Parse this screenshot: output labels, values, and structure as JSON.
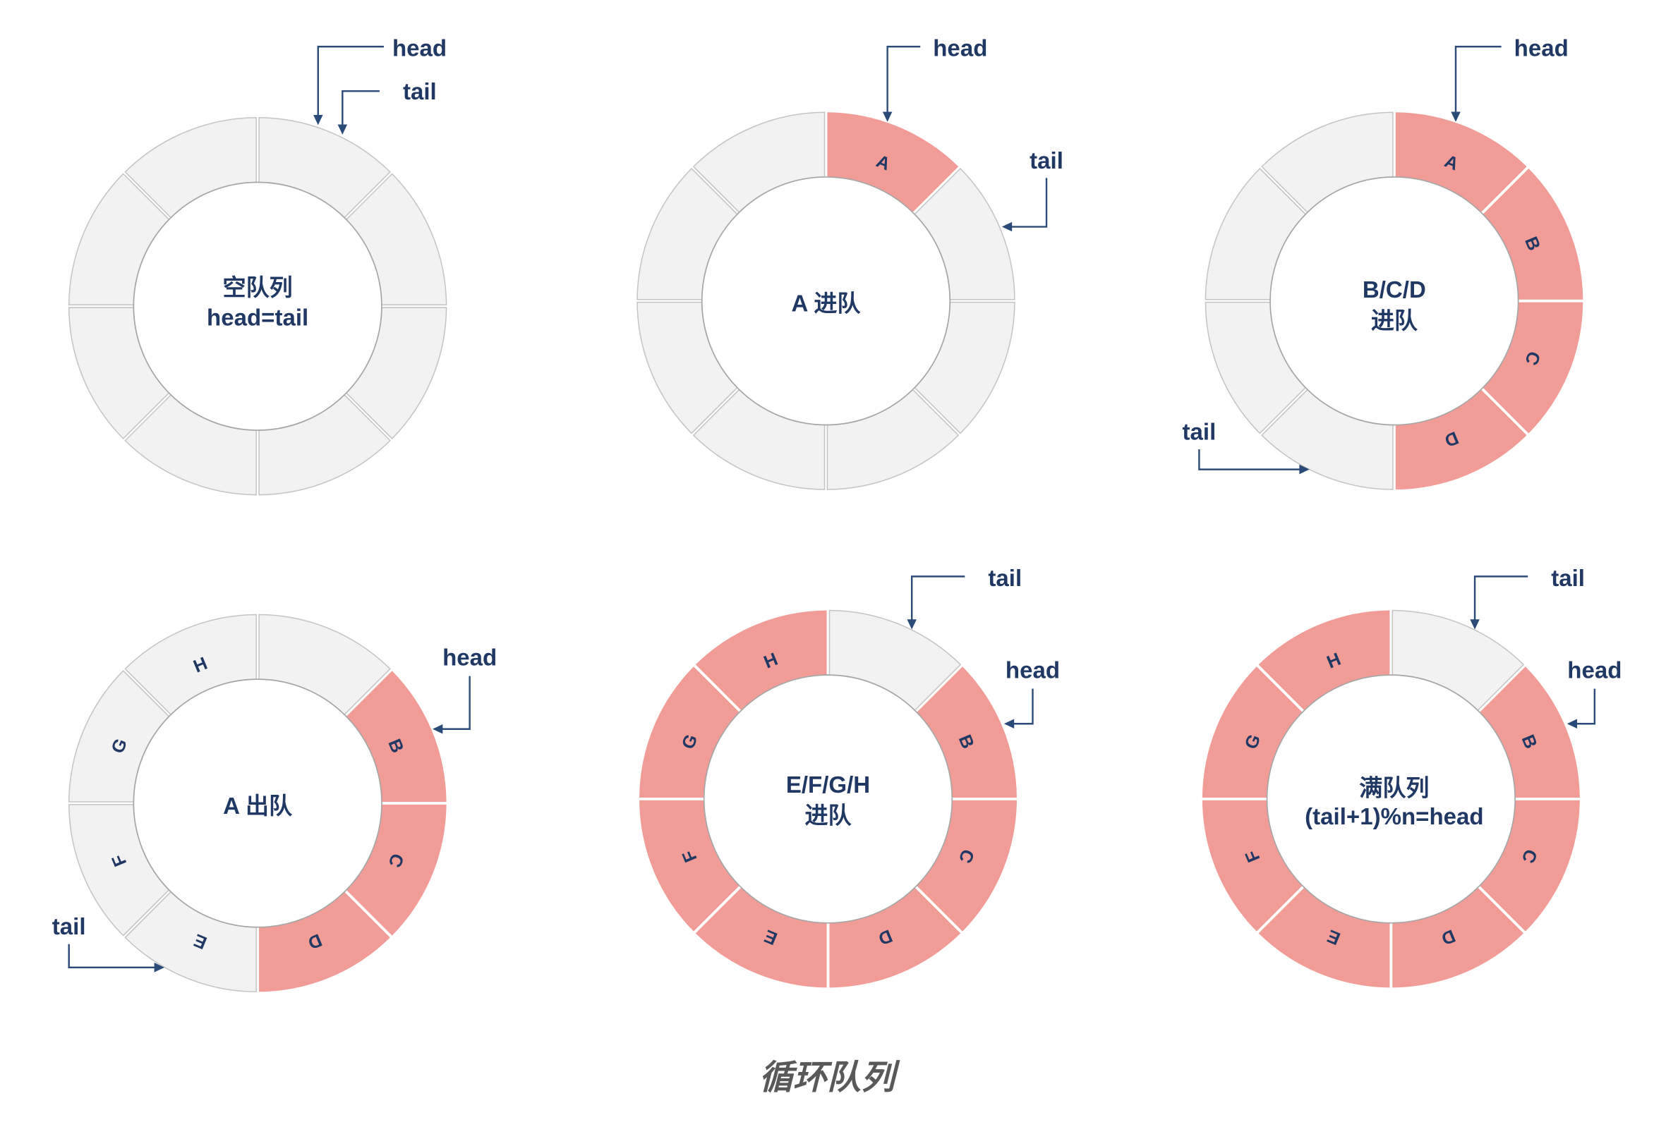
{
  "title": "循环队列",
  "colors": {
    "filled_slot": "#F19C97",
    "empty_slot": "#F2F2F2",
    "slot_border": "#C4C4C4",
    "ring_edge": "#A6A6A6",
    "text": "#203864",
    "pointer": "#2A4A78",
    "title": "#595959"
  },
  "diagrams": [
    {
      "caption": [
        "空队列",
        "head=tail"
      ],
      "slots": [
        {
          "filled": false
        },
        {
          "filled": false
        },
        {
          "filled": false
        },
        {
          "filled": false
        },
        {
          "filled": false
        },
        {
          "filled": false
        },
        {
          "filled": false
        },
        {
          "filled": false
        }
      ],
      "pointers": {
        "head": {
          "label": "head",
          "slot": 0
        },
        "tail": {
          "label": "tail",
          "slot": 0
        }
      }
    },
    {
      "caption": [
        "A 进队"
      ],
      "slots": [
        {
          "label": "A",
          "filled": true
        },
        {
          "filled": false
        },
        {
          "filled": false
        },
        {
          "filled": false
        },
        {
          "filled": false
        },
        {
          "filled": false
        },
        {
          "filled": false
        },
        {
          "filled": false
        }
      ],
      "pointers": {
        "head": {
          "label": "head",
          "slot": 0
        },
        "tail": {
          "label": "tail",
          "slot": 1
        }
      }
    },
    {
      "caption": [
        "B/C/D",
        "进队"
      ],
      "slots": [
        {
          "label": "A",
          "filled": true
        },
        {
          "label": "B",
          "filled": true
        },
        {
          "label": "C",
          "filled": true
        },
        {
          "label": "D",
          "filled": true
        },
        {
          "filled": false
        },
        {
          "filled": false
        },
        {
          "filled": false
        },
        {
          "filled": false
        }
      ],
      "pointers": {
        "head": {
          "label": "head",
          "slot": 0
        },
        "tail": {
          "label": "tail",
          "slot": 4
        }
      }
    },
    {
      "caption": [
        "A 出队"
      ],
      "slots": [
        {
          "filled": false
        },
        {
          "label": "B",
          "filled": true
        },
        {
          "label": "C",
          "filled": true
        },
        {
          "label": "D",
          "filled": true
        },
        {
          "label": "E",
          "filled": false
        },
        {
          "label": "F",
          "filled": false
        },
        {
          "label": "G",
          "filled": false
        },
        {
          "label": "H",
          "filled": false
        }
      ],
      "pointers": {
        "head": {
          "label": "head",
          "slot": 1
        },
        "tail": {
          "label": "tail",
          "slot": 4
        }
      }
    },
    {
      "caption": [
        "E/F/G/H",
        "进队"
      ],
      "slots": [
        {
          "filled": false
        },
        {
          "label": "B",
          "filled": true
        },
        {
          "label": "C",
          "filled": true
        },
        {
          "label": "D",
          "filled": true
        },
        {
          "label": "E",
          "filled": true
        },
        {
          "label": "F",
          "filled": true
        },
        {
          "label": "G",
          "filled": true
        },
        {
          "label": "H",
          "filled": true
        }
      ],
      "pointers": {
        "head": {
          "label": "head",
          "slot": 1
        },
        "tail": {
          "label": "tail",
          "slot": 0
        }
      }
    },
    {
      "caption": [
        "满队列",
        "(tail+1)%n=head"
      ],
      "slots": [
        {
          "filled": false
        },
        {
          "label": "B",
          "filled": true
        },
        {
          "label": "C",
          "filled": true
        },
        {
          "label": "D",
          "filled": true
        },
        {
          "label": "E",
          "filled": true
        },
        {
          "label": "F",
          "filled": true
        },
        {
          "label": "G",
          "filled": true
        },
        {
          "label": "H",
          "filled": true
        }
      ],
      "pointers": {
        "head": {
          "label": "head",
          "slot": 1
        },
        "tail": {
          "label": "tail",
          "slot": 0
        }
      }
    }
  ]
}
